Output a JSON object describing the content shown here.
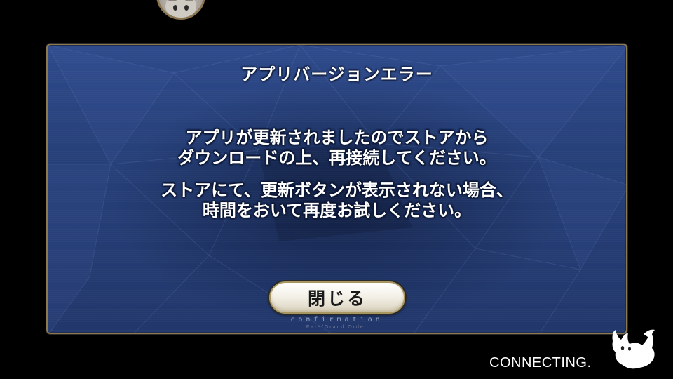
{
  "dialog": {
    "title": "アプリバージョンエラー",
    "message_lines": [
      "アプリが更新されましたのでストアから",
      "ダウンロードの上、再接続してください。",
      "ストアにて、更新ボタンが表示されない場合、",
      "時間をおいて再度お試しください。"
    ],
    "close_label": "閉じる",
    "caption": "confirmation",
    "caption_sub": "Fate/Grand Order"
  },
  "status": {
    "connecting": "CONNECTING."
  },
  "icons": {
    "top_avatar": "character-avatar-icon",
    "mascot": "fou-mascot-icon"
  },
  "colors": {
    "background": "#000000",
    "dialog_blue": "#264079",
    "border_gold": "#8c7a4e",
    "button_cream": "#f4f1e8"
  }
}
